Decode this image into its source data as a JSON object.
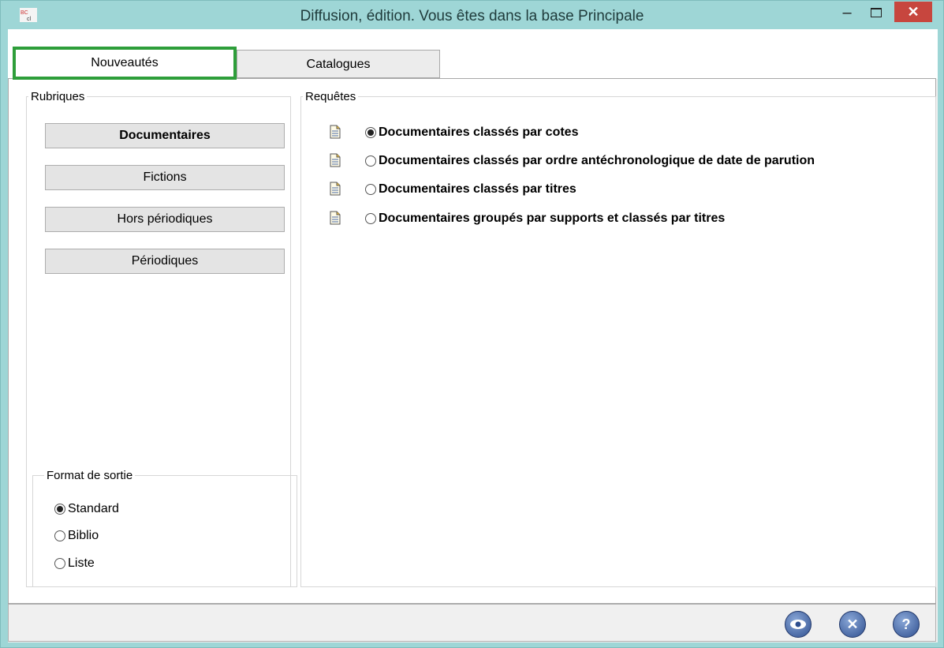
{
  "window": {
    "title": "Diffusion, édition.  Vous êtes dans la base Principale"
  },
  "tabs": [
    {
      "label": "Nouveautés",
      "active": true
    },
    {
      "label": "Catalogues",
      "active": false
    }
  ],
  "rubriques": {
    "legend": "Rubriques",
    "buttons": [
      "Documentaires",
      "Fictions",
      "Hors périodiques",
      "Périodiques"
    ]
  },
  "format": {
    "legend": "Format de sortie",
    "options": [
      "Standard",
      "Biblio",
      "Liste"
    ],
    "selected": "Standard"
  },
  "requetes": {
    "legend": "Requêtes",
    "items": [
      "Documentaires classés par cotes",
      "Documentaires classés par ordre antéchronologique de date de parution",
      "Documentaires classés par titres",
      "Documentaires groupés par supports et classés par titres"
    ],
    "selected_index": 0
  },
  "colors": {
    "titlebar": "#9ed6d6",
    "close": "#c7463e",
    "active_tab_border": "#2e9e3a"
  },
  "toolbar_icons": [
    "preview-eye-icon",
    "cancel-x-icon",
    "help-question-icon"
  ]
}
